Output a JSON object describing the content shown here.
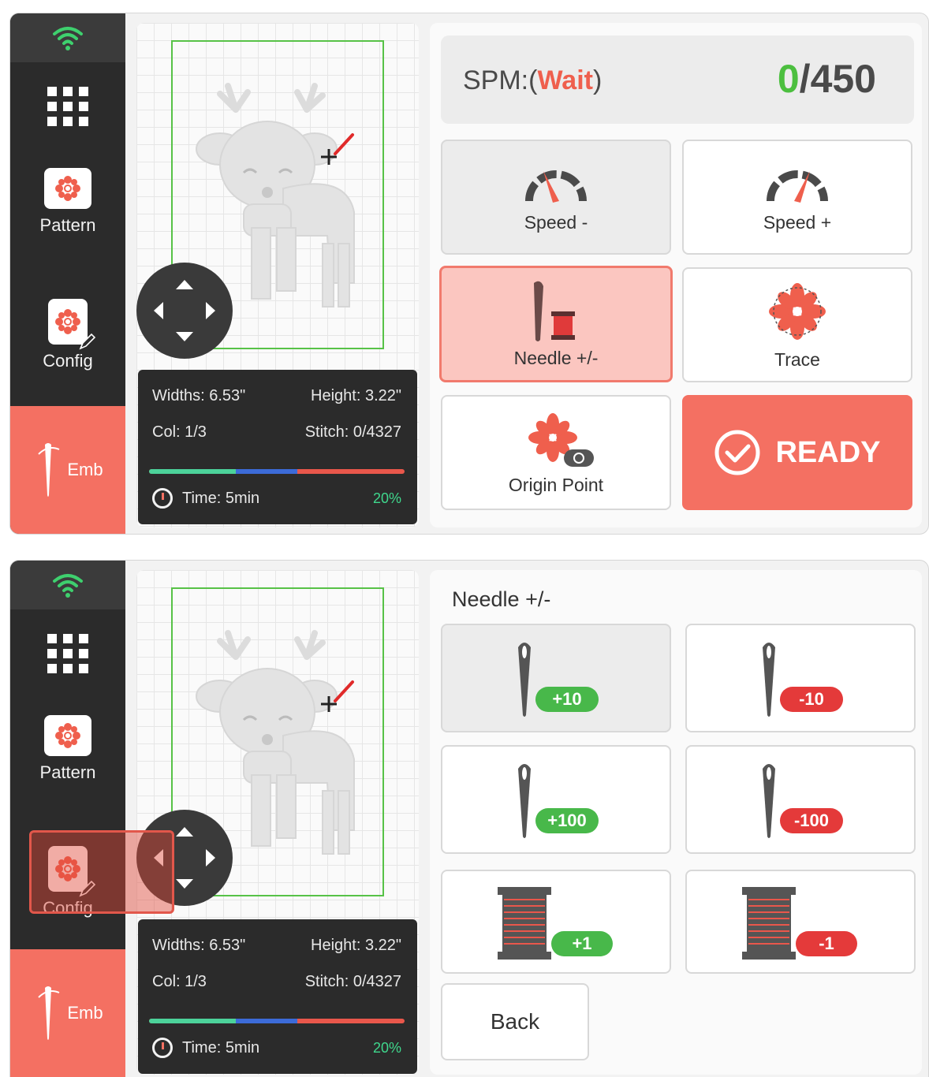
{
  "sidebar": {
    "wifi_icon": "wifi-icon",
    "apps_icon": "grid-icon",
    "pattern_label": "Pattern",
    "config_label": "Config",
    "emb_label": "Emb",
    "accent_color": "#f47062",
    "wifi_color": "#3ed06e"
  },
  "design_info": {
    "width": "Widths: 6.53\"",
    "height": "Height: 3.22\"",
    "color": "Col: 1/3",
    "stitch": "Stitch: 0/4327",
    "time": "Time: 5min",
    "percent": "20%",
    "progress_fraction": 0.2
  },
  "screen1": {
    "spm_prefix": "SPM:(",
    "spm_state": "Wait",
    "spm_suffix": ")",
    "spm_current": "0",
    "spm_max": "/450",
    "buttons": {
      "speed_down": "Speed -",
      "speed_up": "Speed +",
      "needle": "Needle +/-",
      "trace": "Trace",
      "origin": "Origin Point",
      "ready": "READY"
    }
  },
  "screen2": {
    "title": "Needle +/-",
    "buttons": {
      "plus10": "+10",
      "minus10": "-10",
      "plus100": "+100",
      "minus100": "-100",
      "plus1": "+1",
      "minus1": "-1",
      "back": "Back"
    }
  }
}
